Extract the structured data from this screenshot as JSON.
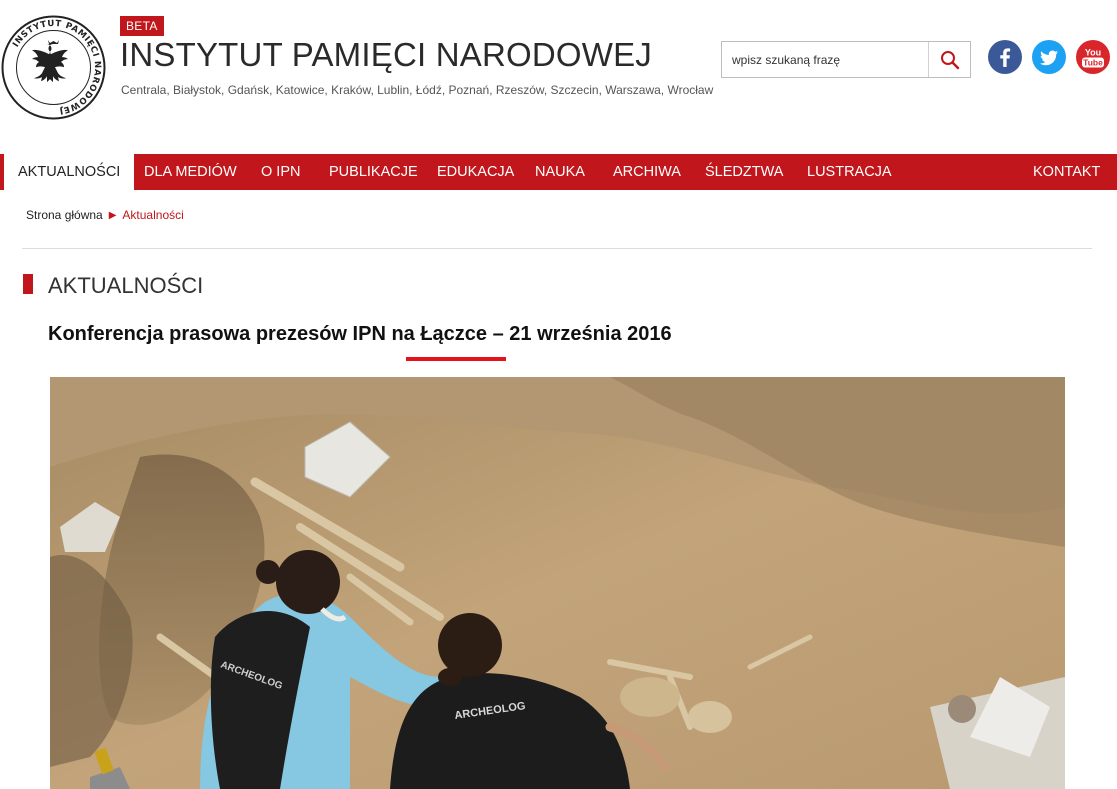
{
  "header": {
    "beta_label": "BETA",
    "site_title": "INSTYTUT PAMIĘCI NARODOWEJ",
    "cities": "Centrala, Białystok, Gdańsk, Katowice, Kraków, Lublin, Łódź, Poznań, Rzeszów, Szczecin, Warszawa, Wrocław",
    "logo_text": "INSTYTUT PAMIĘCI NARODOWEJ",
    "search_placeholder": "wpisz szukaną frazę",
    "social": [
      "facebook-icon",
      "twitter-icon",
      "youtube-icon"
    ],
    "youtube_label_top": "You",
    "youtube_label_bottom": "Tube"
  },
  "nav": {
    "items": [
      {
        "label": "AKTUALNOŚCI",
        "active": true
      },
      {
        "label": "DLA MEDIÓW"
      },
      {
        "label": "O IPN"
      },
      {
        "label": "PUBLIKACJE"
      },
      {
        "label": "EDUKACJA"
      },
      {
        "label": "NAUKA"
      },
      {
        "label": "ARCHIWA"
      },
      {
        "label": "ŚLEDZTWA"
      },
      {
        "label": "LUSTRACJA"
      },
      {
        "label": "KONTAKT"
      }
    ]
  },
  "breadcrumb": {
    "home": "Strona główna",
    "current": "Aktualności"
  },
  "section": {
    "title": "AKTUALNOŚCI"
  },
  "article": {
    "title": "Konferencja prasowa prezesów IPN na Łączce – 21 września 2016",
    "photo_shirt_text_1": "ARCHEOLOG",
    "photo_shirt_text_2": "ARCHEOLOG"
  },
  "colors": {
    "brand_red": "#c0161c",
    "facebook": "#3b5998",
    "twitter": "#1da1f2",
    "youtube": "#d9262a"
  }
}
